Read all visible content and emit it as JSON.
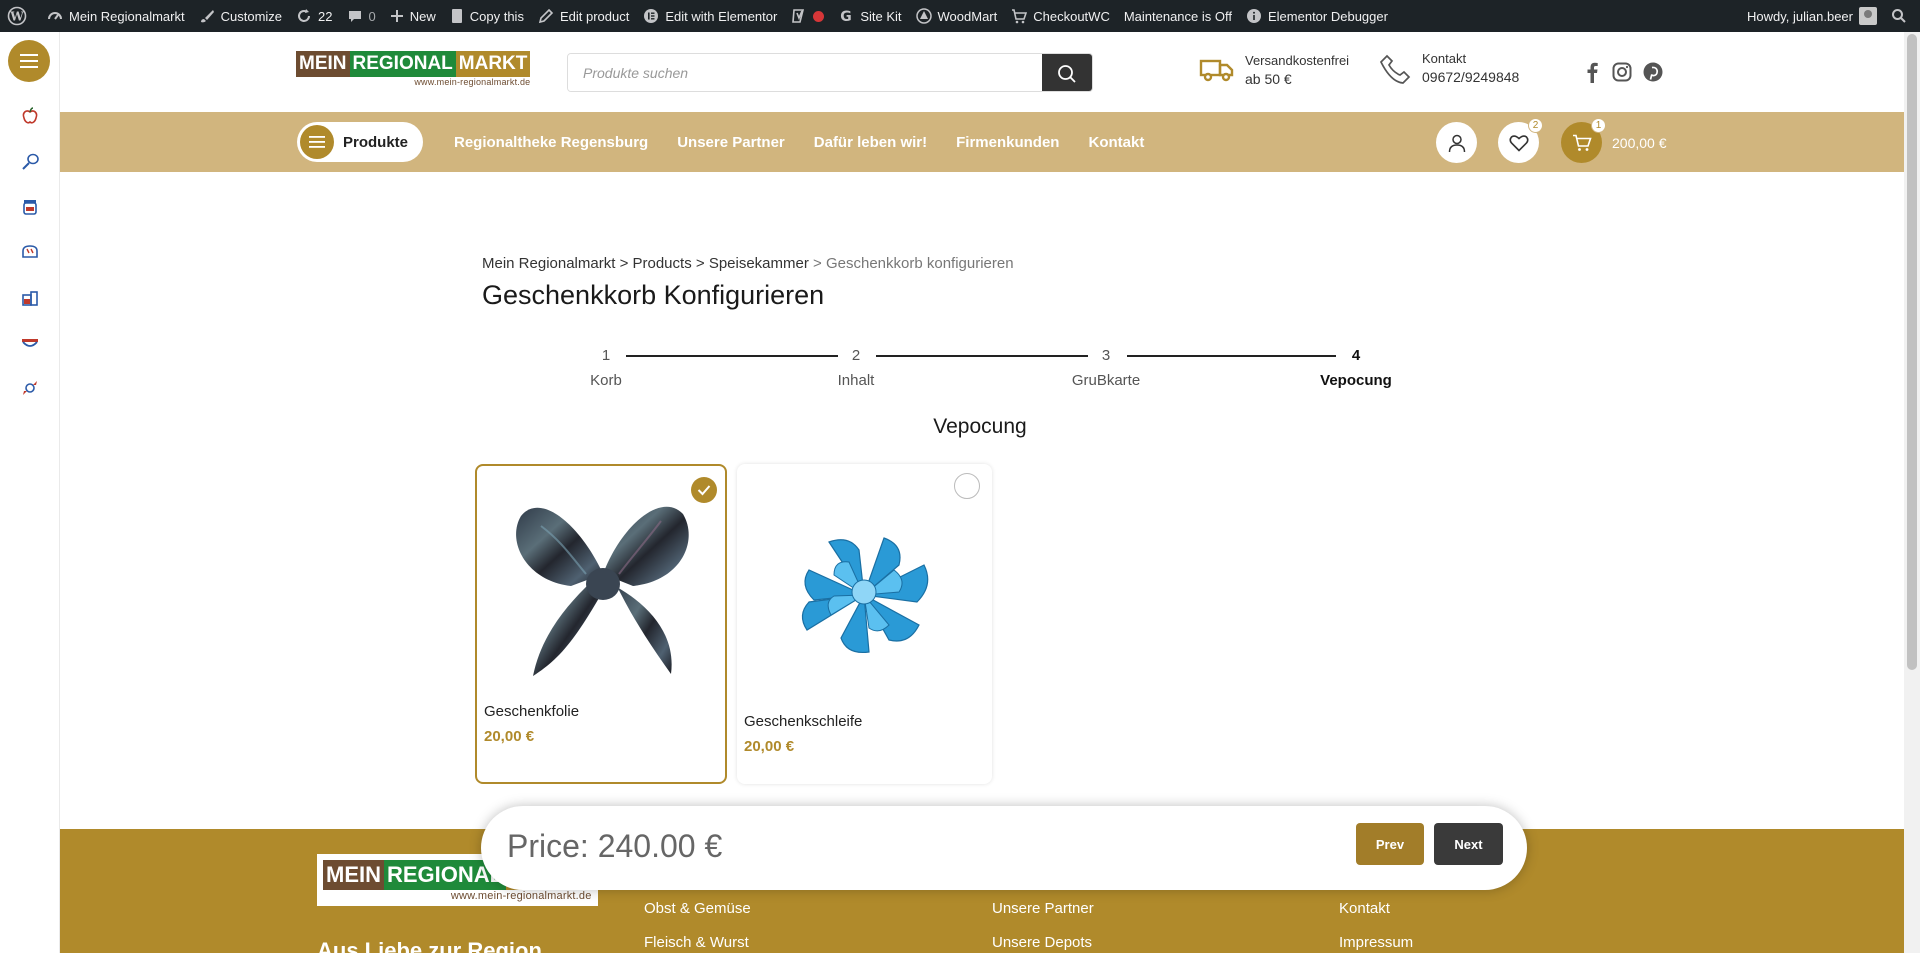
{
  "adminbar": {
    "site_name": "Mein Regionalmarkt",
    "customize": "Customize",
    "updates": "22",
    "comments": "0",
    "new": "New",
    "copy_this": "Copy this",
    "edit_product": "Edit product",
    "edit_elementor": "Edit with Elementor",
    "site_kit": "Site Kit",
    "woodmart": "WoodMart",
    "checkoutwc": "CheckoutWC",
    "maintenance": "Maintenance is Off",
    "debugger": "Elementor Debugger",
    "howdy": "Howdy, julian.beer"
  },
  "header": {
    "logo": {
      "part1": "MEIN",
      "part2": "REGIONAL",
      "part3": "MARKT",
      "url": "www.mein-regionalmarkt.de"
    },
    "search_placeholder": "Produkte suchen",
    "shipping": {
      "line1": "Versandkostenfrei",
      "line2": "ab 50 €"
    },
    "contact": {
      "line1": "Kontakt",
      "line2": "09672/9249848"
    }
  },
  "nav": {
    "products_label": "Produkte",
    "links": [
      "Regionaltheke Regensburg",
      "Unsere Partner",
      "Dafür leben wir!",
      "Firmenkunden",
      "Kontakt"
    ],
    "wishlist_count": "2",
    "cart_count": "1",
    "cart_total": "200,00 €"
  },
  "breadcrumb": {
    "home": "Mein Regionalmarkt",
    "sep": ">",
    "products": "Products",
    "category": "Speisekammer",
    "current": "Geschenkkorb konfigurieren"
  },
  "page_title": "Geschenkkorb Konfigurieren",
  "steps": [
    {
      "num": "1",
      "label": "Korb",
      "active": false
    },
    {
      "num": "2",
      "label": "Inhalt",
      "active": false
    },
    {
      "num": "3",
      "label": "GruBkarte",
      "active": false
    },
    {
      "num": "4",
      "label": "Vepocung",
      "active": true
    }
  ],
  "section_title": "Vepocung",
  "products": [
    {
      "name": "Geschenkfolie",
      "price": "20,00 €",
      "selected": true
    },
    {
      "name": "Geschenkschleife",
      "price": "20,00 €",
      "selected": false
    }
  ],
  "pricebar": {
    "price": "Price: 240.00 €",
    "prev": "Prev",
    "next": "Next",
    "prev_color": "#a27d29",
    "next_color": "#3a3a3a"
  },
  "footer": {
    "col1": [
      "Obst & Gemüse",
      "Fleisch & Wurst"
    ],
    "col2": [
      "Unsere Partner",
      "Unsere Depots"
    ],
    "col3": [
      "Kontakt",
      "Impressum"
    ],
    "tagline": "Aus Liebe zur Region"
  },
  "colors": {
    "accent": "#b08a2b",
    "navbar": "#d1b57e",
    "adminbar": "#1d2327"
  }
}
